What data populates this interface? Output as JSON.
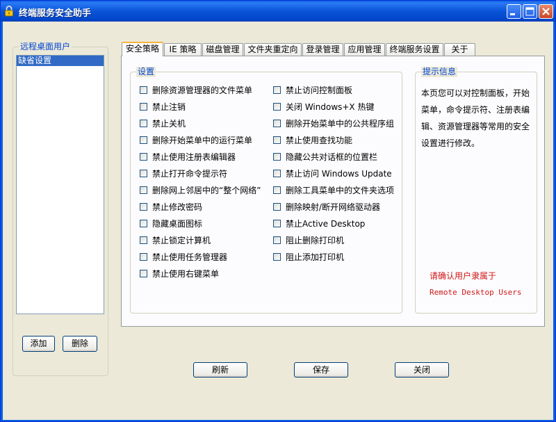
{
  "window": {
    "title": "终端服务安全助手",
    "icon": "lock-icon"
  },
  "left_panel": {
    "group_title": "远程桌面用户",
    "users": [
      "缺省设置"
    ],
    "add_label": "添加",
    "delete_label": "删除"
  },
  "tabs": [
    {
      "label": "安全策略",
      "active": true
    },
    {
      "label": "IE 策略",
      "active": false
    },
    {
      "label": "磁盘管理",
      "active": false
    },
    {
      "label": "文件夹重定向",
      "active": false
    },
    {
      "label": "登录管理",
      "active": false
    },
    {
      "label": "应用管理",
      "active": false
    },
    {
      "label": "终端服务设置",
      "active": false
    },
    {
      "label": "关于",
      "active": false
    }
  ],
  "settings": {
    "group_title": "设置",
    "col1": [
      "删除资源管理器的文件菜单",
      "禁止注销",
      "禁止关机",
      "删除开始菜单中的运行菜单",
      "禁止使用注册表编辑器",
      "禁止打开命令提示符",
      "删除网上邻居中的“整个网络”",
      "禁止修改密码",
      "隐藏桌面图标",
      "禁止锁定计算机",
      "禁止使用任务管理器",
      "禁止使用右键菜单"
    ],
    "col2": [
      "禁止访问控制面板",
      "关闭 Windows+X 热键",
      "删除开始菜单中的公共程序组",
      "禁止使用查找功能",
      "隐藏公共对话框的位置栏",
      "禁止访问 Windows Update",
      "删除工具菜单中的文件夹选项",
      "删除映射/断开网络驱动器",
      "禁止Active Desktop",
      "阻止删除打印机",
      "阻止添加打印机"
    ]
  },
  "hint": {
    "group_title": "提示信息",
    "text": "本页您可以对控制面板，开始菜单，命令提示符、注册表编辑、资源管理器等常用的安全设置进行修改。",
    "warning_line1": "请确认用户隶属于",
    "warning_line2": "Remote Desktop Users"
  },
  "footer": {
    "refresh_label": "刷新",
    "save_label": "保存",
    "close_label": "关闭"
  },
  "colors": {
    "titlebar": "#0a54d8",
    "group_title": "#0046d5",
    "warning": "#d01818",
    "selection": "#316ac5"
  }
}
